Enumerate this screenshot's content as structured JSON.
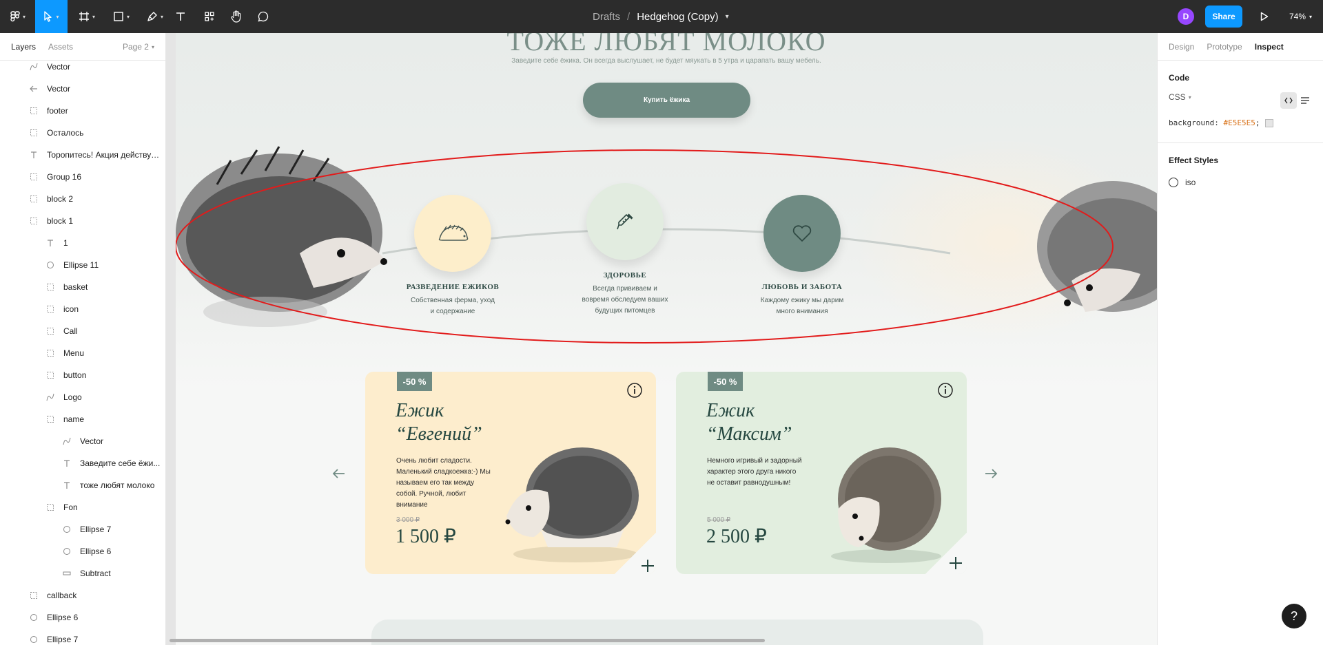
{
  "toolbar": {
    "breadcrumb": "Drafts",
    "separator": "/",
    "file_name": "Hedgehog (Copy)",
    "avatar_initial": "D",
    "share_label": "Share",
    "zoom": "74%"
  },
  "left_panel": {
    "tabs": [
      "Layers",
      "Assets"
    ],
    "page": "Page 2",
    "layers": [
      {
        "label": "Vector",
        "icon": "vector-icon"
      },
      {
        "label": "Vector",
        "icon": "arrow-left-icon"
      },
      {
        "label": "footer",
        "icon": "frame-icon"
      },
      {
        "label": "Осталось",
        "icon": "frame-icon"
      },
      {
        "label": "Торопитесь! Акция действуе...",
        "icon": "text-icon"
      },
      {
        "label": "Group 16",
        "icon": "frame-icon"
      },
      {
        "label": "block 2",
        "icon": "frame-icon"
      },
      {
        "label": "block 1",
        "icon": "frame-icon"
      },
      {
        "label": "1",
        "icon": "text-icon"
      },
      {
        "label": "Ellipse 11",
        "icon": "ellipse-icon"
      },
      {
        "label": "basket",
        "icon": "frame-icon"
      },
      {
        "label": "icon",
        "icon": "frame-icon"
      },
      {
        "label": "Call",
        "icon": "frame-icon"
      },
      {
        "label": "Menu",
        "icon": "frame-icon"
      },
      {
        "label": "button",
        "icon": "frame-icon"
      },
      {
        "label": "Logo",
        "icon": "vector-icon"
      },
      {
        "label": "name",
        "icon": "frame-icon"
      },
      {
        "label": "Vector",
        "icon": "vector-icon"
      },
      {
        "label": "Заведите себе ёжи...",
        "icon": "text-icon"
      },
      {
        "label": "тоже любят молоко",
        "icon": "text-icon"
      },
      {
        "label": "Fon",
        "icon": "frame-icon"
      },
      {
        "label": "Ellipse 7",
        "icon": "ellipse-icon"
      },
      {
        "label": "Ellipse 6",
        "icon": "ellipse-icon"
      },
      {
        "label": "Subtract",
        "icon": "rect-icon"
      },
      {
        "label": "callback",
        "icon": "frame-icon"
      },
      {
        "label": "Ellipse 6",
        "icon": "ellipse-icon"
      },
      {
        "label": "Ellipse 7",
        "icon": "ellipse-icon"
      }
    ]
  },
  "canvas": {
    "hero_title": "ТОЖЕ ЛЮБЯТ МОЛОКО",
    "hero_subtitle": "Заведите себе ёжика. Он всегда выслушает, не будет мяукать в 5 утра и царапать вашу мебель.",
    "buy_button": "Купить ёжика",
    "features": [
      {
        "title": "РАЗВЕДЕНИЕ ЕЖИКОВ",
        "desc_1": "Собственная ферма, уход",
        "desc_2": "и содержание",
        "desc_3": "",
        "color": "#fdeecb",
        "icon": "hedgehog-icon"
      },
      {
        "title": "ЗДОРОВЬЕ",
        "desc_1": "Всегда прививаем и",
        "desc_2": "вовремя обследуем ваших",
        "desc_3": "будущих питомцев",
        "color": "#e2ece0",
        "icon": "syringe-icon"
      },
      {
        "title": "ЛЮБОВЬ И ЗАБОТА",
        "desc_1": "Каждому ежику мы дарим",
        "desc_2": "много внимания",
        "desc_3": "",
        "color": "#6f8b83",
        "icon": "heart-icon"
      }
    ],
    "cards": [
      {
        "badge": "-50 %",
        "title_1": "Ежик",
        "title_2": "“Евгений”",
        "desc": "Очень любит сладости. Маленький сладкоежка:-) Мы называем его так между собой. Ручной, любит внимание",
        "old_price": "3 000 ₽",
        "price": "1 500 ₽",
        "bg": "#fdedcd"
      },
      {
        "badge": "-50 %",
        "title_1": "Ежик",
        "title_2": "“Максим”",
        "desc": "Немного игривый и задорный характер этого друга никого не оставит равнодушным!",
        "old_price": "5 000 ₽",
        "price": "2 500 ₽",
        "bg": "#e2eedf"
      }
    ]
  },
  "right_panel": {
    "tabs": [
      "Design",
      "Prototype",
      "Inspect"
    ],
    "code_heading": "Code",
    "language": "CSS",
    "css_property": "background:",
    "css_value": "#E5E5E5",
    "css_semicolon": ";",
    "effect_heading": "Effect Styles",
    "effect_name": "iso"
  },
  "help_label": "?"
}
